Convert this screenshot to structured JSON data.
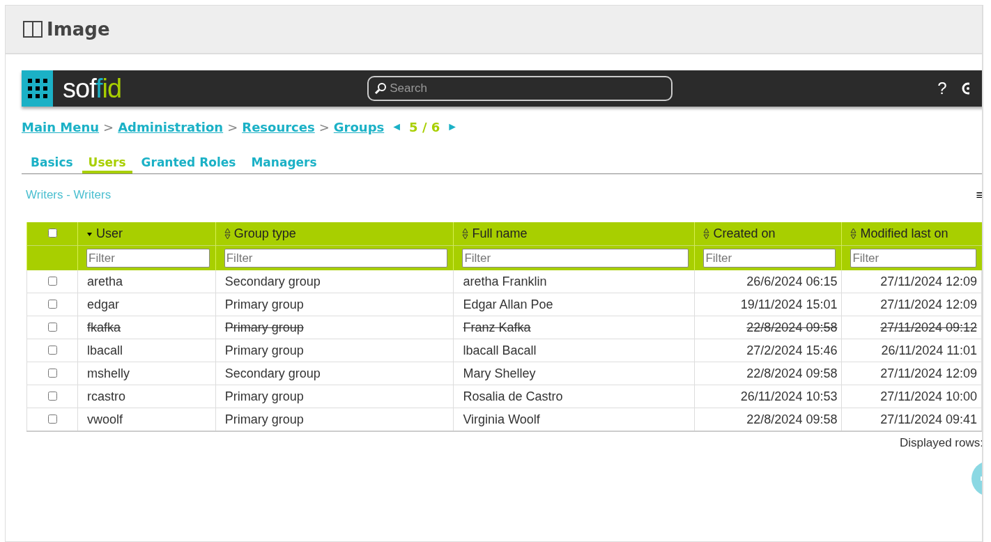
{
  "window": {
    "title": "Image"
  },
  "navbar": {
    "logo": "soffid",
    "search": {
      "placeholder": "Search"
    },
    "help": "?"
  },
  "breadcrumb": {
    "items": [
      "Main Menu",
      "Administration",
      "Resources",
      "Groups"
    ],
    "separator": ">",
    "pager": "5 / 6",
    "prev": "◄",
    "next": "►"
  },
  "tabs": [
    {
      "label": "Basics",
      "selected": false
    },
    {
      "label": "Users",
      "selected": true
    },
    {
      "label": "Granted Roles",
      "selected": false
    },
    {
      "label": "Managers",
      "selected": false
    }
  ],
  "subtitle": "Writers - Writers",
  "menu": "≡",
  "table": {
    "select_all": {
      "checked": false
    },
    "columns": [
      {
        "label": "User",
        "sorted": true,
        "filter_placeholder": "Filter",
        "kind": "text"
      },
      {
        "label": "Group type",
        "sorted": false,
        "filter_placeholder": "Filter",
        "kind": "text"
      },
      {
        "label": "Full name",
        "sorted": false,
        "filter_placeholder": "Filter",
        "kind": "text"
      },
      {
        "label": "Created on",
        "sorted": false,
        "filter_placeholder": "Filter",
        "kind": "date"
      },
      {
        "label": "Modified last on",
        "sorted": false,
        "filter_placeholder": "Filter",
        "kind": "date"
      }
    ],
    "rows": [
      {
        "checked": false,
        "removed": false,
        "cells": [
          "aretha",
          "Secondary group",
          "aretha Franklin",
          "26/6/2024 06:15",
          "27/11/2024 12:09"
        ]
      },
      {
        "checked": false,
        "removed": false,
        "cells": [
          "edgar",
          "Primary group",
          "Edgar Allan Poe",
          "19/11/2024 15:01",
          "27/11/2024 12:09"
        ]
      },
      {
        "checked": false,
        "removed": true,
        "cells": [
          "fkafka",
          "Primary group",
          "Franz Kafka",
          "22/8/2024 09:58",
          "27/11/2024 09:12"
        ]
      },
      {
        "checked": false,
        "removed": false,
        "cells": [
          "lbacall",
          "Primary group",
          "lbacall Bacall",
          "27/2/2024 15:46",
          "26/11/2024 11:01"
        ]
      },
      {
        "checked": false,
        "removed": false,
        "cells": [
          "mshelly",
          "Secondary group",
          "Mary Shelley",
          "22/8/2024 09:58",
          "27/11/2024 12:09"
        ]
      },
      {
        "checked": false,
        "removed": false,
        "cells": [
          "rcastro",
          "Primary group",
          "Rosalia de Castro",
          "26/11/2024 10:53",
          "27/11/2024 10:00"
        ]
      },
      {
        "checked": false,
        "removed": false,
        "cells": [
          "vwoolf",
          "Primary group",
          "Virginia Woolf",
          "22/8/2024 09:58",
          "27/11/2024 09:41"
        ]
      }
    ]
  },
  "footer": {
    "displayed_rows": "Displayed rows:"
  }
}
